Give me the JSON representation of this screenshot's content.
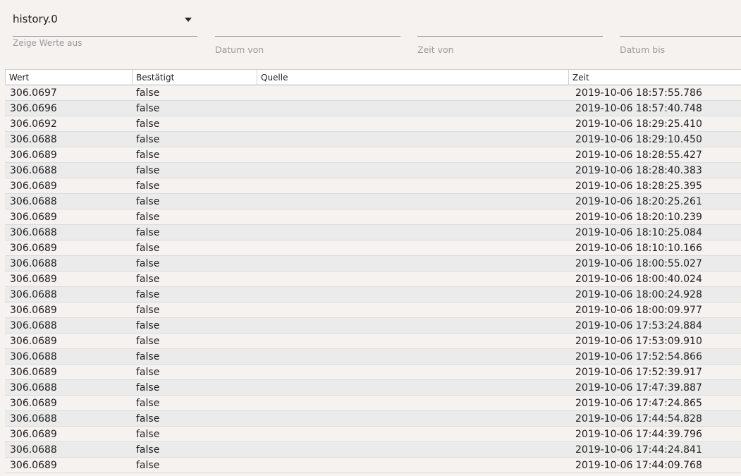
{
  "filters": {
    "history_select": {
      "value": "history.0",
      "helper": "Zeige Werte aus"
    },
    "date_from": {
      "label": "Datum von"
    },
    "time_from": {
      "label": "Zeit von"
    },
    "date_to": {
      "label": "Datum bis"
    }
  },
  "table": {
    "columns": [
      "Wert",
      "Bestätigt",
      "Quelle",
      "Zeit"
    ],
    "rows": [
      [
        "306.0697",
        "false",
        "",
        "2019-10-06 18:57:55.786"
      ],
      [
        "306.0696",
        "false",
        "",
        "2019-10-06 18:57:40.748"
      ],
      [
        "306.0692",
        "false",
        "",
        "2019-10-06 18:29:25.410"
      ],
      [
        "306.0688",
        "false",
        "",
        "2019-10-06 18:29:10.450"
      ],
      [
        "306.0689",
        "false",
        "",
        "2019-10-06 18:28:55.427"
      ],
      [
        "306.0688",
        "false",
        "",
        "2019-10-06 18:28:40.383"
      ],
      [
        "306.0689",
        "false",
        "",
        "2019-10-06 18:28:25.395"
      ],
      [
        "306.0688",
        "false",
        "",
        "2019-10-06 18:20:25.261"
      ],
      [
        "306.0689",
        "false",
        "",
        "2019-10-06 18:20:10.239"
      ],
      [
        "306.0688",
        "false",
        "",
        "2019-10-06 18:10:25.084"
      ],
      [
        "306.0689",
        "false",
        "",
        "2019-10-06 18:10:10.166"
      ],
      [
        "306.0688",
        "false",
        "",
        "2019-10-06 18:00:55.027"
      ],
      [
        "306.0689",
        "false",
        "",
        "2019-10-06 18:00:40.024"
      ],
      [
        "306.0688",
        "false",
        "",
        "2019-10-06 18:00:24.928"
      ],
      [
        "306.0689",
        "false",
        "",
        "2019-10-06 18:00:09.977"
      ],
      [
        "306.0688",
        "false",
        "",
        "2019-10-06 17:53:24.884"
      ],
      [
        "306.0689",
        "false",
        "",
        "2019-10-06 17:53:09.910"
      ],
      [
        "306.0688",
        "false",
        "",
        "2019-10-06 17:52:54.866"
      ],
      [
        "306.0689",
        "false",
        "",
        "2019-10-06 17:52:39.917"
      ],
      [
        "306.0688",
        "false",
        "",
        "2019-10-06 17:47:39.887"
      ],
      [
        "306.0689",
        "false",
        "",
        "2019-10-06 17:47:24.865"
      ],
      [
        "306.0688",
        "false",
        "",
        "2019-10-06 17:44:54.828"
      ],
      [
        "306.0689",
        "false",
        "",
        "2019-10-06 17:44:39.796"
      ],
      [
        "306.0688",
        "false",
        "",
        "2019-10-06 17:44:24.841"
      ],
      [
        "306.0689",
        "false",
        "",
        "2019-10-06 17:44:09.768"
      ]
    ]
  }
}
